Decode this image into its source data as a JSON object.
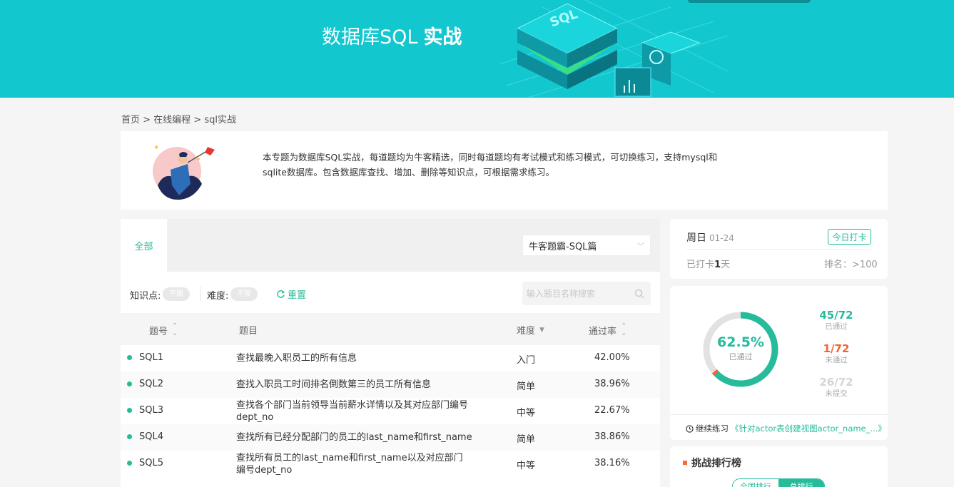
{
  "banner": {
    "title_main": "数据库SQL",
    "title_bold": "实战",
    "art_text": "SQL"
  },
  "breadcrumb": "首页 > 在线编程 > sql实战",
  "intro": {
    "text": "本专题为数据库SQL实战，每道题均为牛客精选，同时每道题均有考试模式和练习模式，可切换练习，支持mysql和sqlite数据库。包含数据库查找、增加、删除等知识点，可根据需求练习。"
  },
  "tabs": {
    "all": "全部"
  },
  "select": {
    "value": "牛客题霸-SQL篇"
  },
  "filters": {
    "knowledge_label": "知识点:",
    "knowledge_value": "不限",
    "difficulty_label": "难度:",
    "difficulty_value": "不限",
    "reset": "重置",
    "search_placeholder": "输入题目名称搜索"
  },
  "table": {
    "headers": {
      "num": "题号",
      "title": "题目",
      "difficulty": "难度",
      "rate": "通过率"
    },
    "rows": [
      {
        "num": "SQL1",
        "title": "查找最晚入职员工的所有信息",
        "difficulty": "入门",
        "rate": "42.00%"
      },
      {
        "num": "SQL2",
        "title": "查找入职员工时间排名倒数第三的员工所有信息",
        "difficulty": "简单",
        "rate": "38.96%"
      },
      {
        "num": "SQL3",
        "title": "查找各个部门当前领导当前薪水详情以及其对应部门编号dept_no",
        "difficulty": "中等",
        "rate": "22.67%"
      },
      {
        "num": "SQL4",
        "title": "查找所有已经分配部门的员工的last_name和first_name",
        "difficulty": "简单",
        "rate": "38.86%"
      },
      {
        "num": "SQL5",
        "title": "查找所有员工的last_name和first_name以及对应部门编号dept_no",
        "difficulty": "中等",
        "rate": "38.16%"
      }
    ]
  },
  "checkin": {
    "day": "周日",
    "date": "01-24",
    "button": "今日打卡",
    "days_prefix": "已打卡",
    "days_count": "1",
    "days_suffix": "天",
    "rank": "排名：>100"
  },
  "stats": {
    "percent": "62.5%",
    "percent_label": "已通过",
    "pass_fraction": 0.625,
    "fail_fraction": 0.0139,
    "passed": {
      "value": "45/72",
      "label": "已通过"
    },
    "failed": {
      "value": "1/72",
      "label": "未通过"
    },
    "unsubmitted": {
      "value": "26/72",
      "label": "未提交"
    },
    "continue_label": "继续练习",
    "continue_link": "《针对actor表创建视图actor_name_...》"
  },
  "ranking": {
    "title": "挑战排行榜",
    "tab_1": "全国排行",
    "tab_2": "总排行"
  },
  "colors": {
    "accent": "#25bb9b",
    "banner": "#13c7cf",
    "fail": "#f0642f"
  }
}
